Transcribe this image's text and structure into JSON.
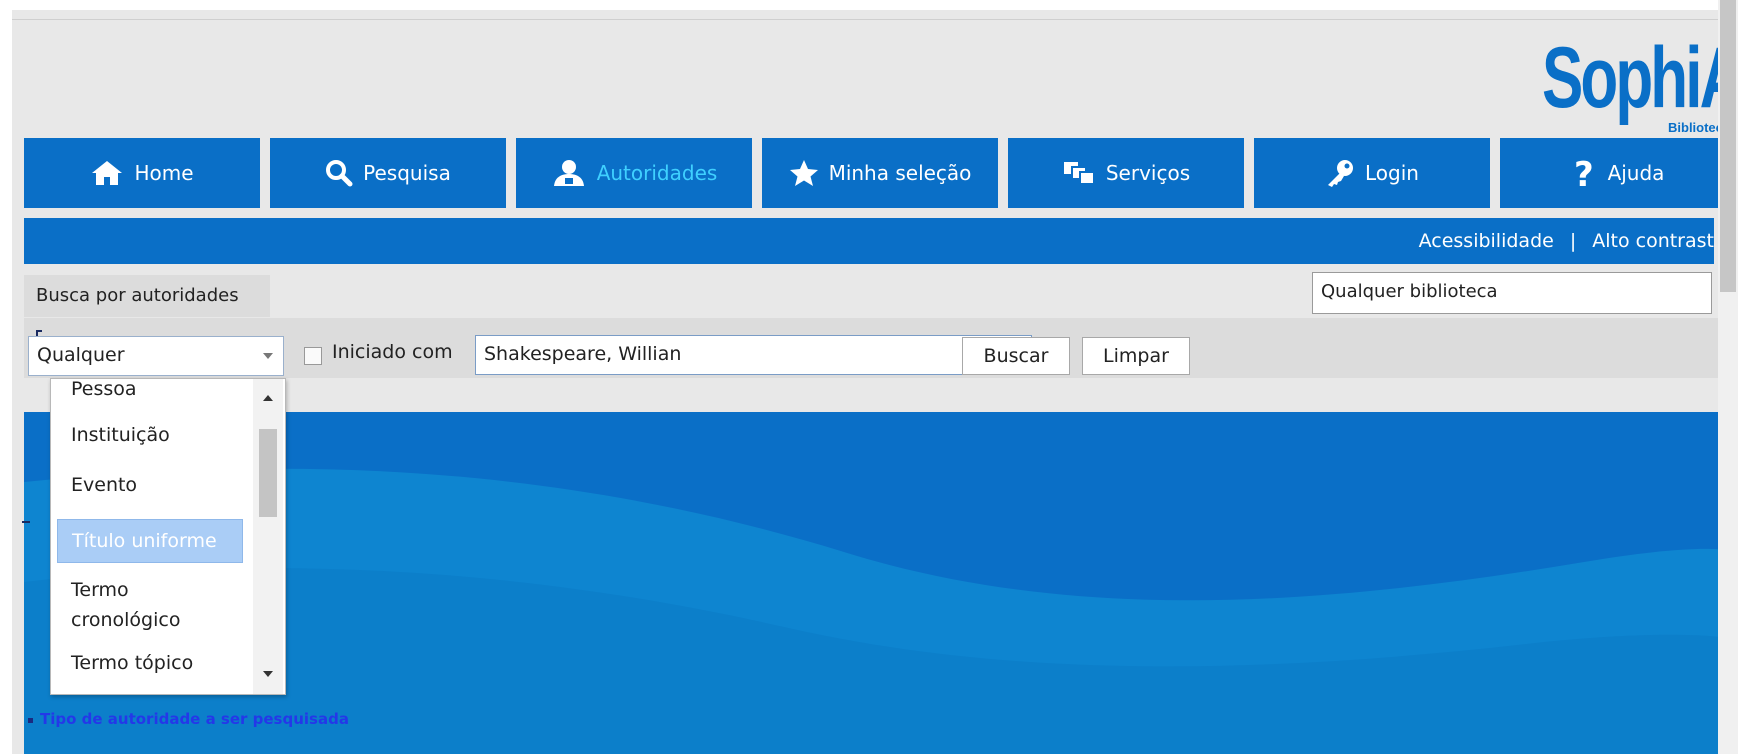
{
  "logo": {
    "text": "SophiA",
    "sub": "Bibliotec"
  },
  "nav": [
    {
      "label": "Home",
      "icon": "home-icon"
    },
    {
      "label": "Pesquisa",
      "icon": "search-icon"
    },
    {
      "label": "Autoridades",
      "icon": "user-group-icon",
      "active": true
    },
    {
      "label": "Minha seleção",
      "icon": "star-icon"
    },
    {
      "label": "Serviços",
      "icon": "windows-icon"
    },
    {
      "label": "Login",
      "icon": "key-icon"
    },
    {
      "label": "Ajuda",
      "icon": "question-icon"
    }
  ],
  "links": {
    "accessibility": "Acessibilidade",
    "separator": "|",
    "contrast": "Alto contrast"
  },
  "tab": {
    "label": "Busca por autoridades"
  },
  "library_select": {
    "value": "Qualquer biblioteca"
  },
  "search": {
    "type_value": "Qualquer",
    "starts_with_label": "Iniciado com",
    "query_value": "Shakespeare, Willian",
    "search_button": "Buscar",
    "clear_button": "Limpar"
  },
  "dropdown": {
    "items": [
      "Pessoa",
      "Instituição",
      "Evento",
      "Título uniforme",
      "Termo cronológico",
      "Termo tópico"
    ],
    "selected": "Título uniforme"
  },
  "hint": "Tipo de autoridade a ser pesquisada",
  "colors": {
    "brand": "#0a6fc7",
    "active_text": "#3fd0ff",
    "hint": "#2438e8",
    "selection": "#aacdf6"
  }
}
